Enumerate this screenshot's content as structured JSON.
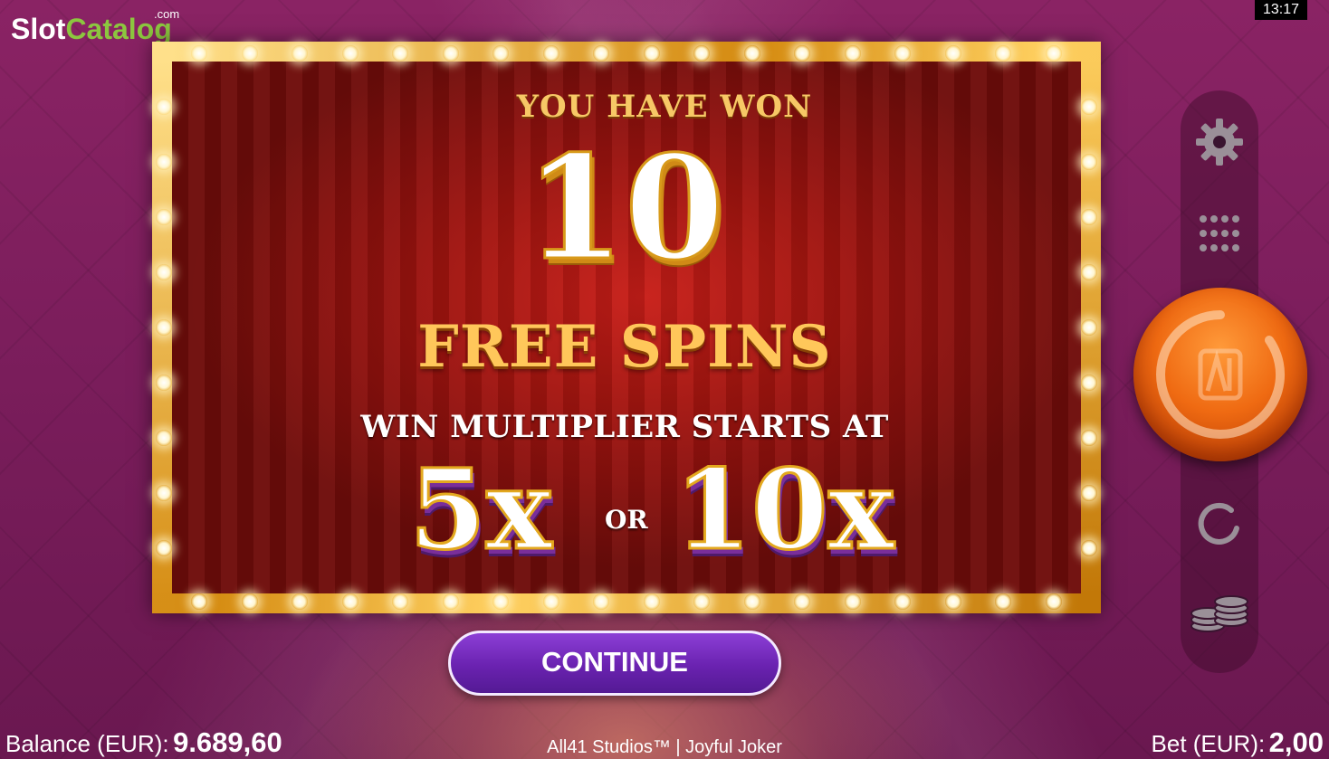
{
  "watermark": {
    "slot": "Slot",
    "catalog": "Catalog",
    "com": ".com"
  },
  "clock": "13:17",
  "popup": {
    "heading": "YOU HAVE WON",
    "spin_count": "10",
    "spins_label": "FREE SPINS",
    "multiplier_text": "WIN MULTIPLIER STARTS AT",
    "multiplier_a": "5x",
    "or_label": "OR",
    "multiplier_b": "10x"
  },
  "continue_label": "CONTINUE",
  "sidebar": {
    "icons": [
      "gear-icon",
      "menu-grid-icon",
      "spin-button",
      "autoplay-icon",
      "coin-stack-icon"
    ]
  },
  "footer": {
    "balance_label": "Balance (EUR):",
    "balance_value": "9.689,60",
    "studio_text": "All41 Studios™ | Joyful Joker",
    "bet_label": "Bet (EUR):",
    "bet_value": "2,00"
  },
  "colors": {
    "frame_gold": "#e8ad2a",
    "curtain_red": "#a0140f",
    "button_purple": "#6a22b0",
    "spin_orange": "#ef6a12",
    "background_magenta": "#7a1d5b"
  }
}
